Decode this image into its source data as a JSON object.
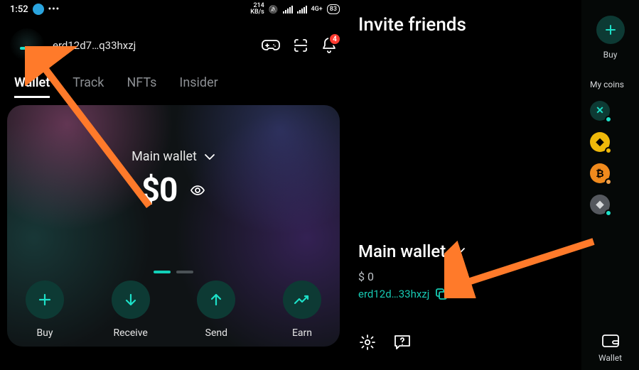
{
  "status": {
    "time": "1:52",
    "kb_top": "214",
    "kb_bottom": "KB/s",
    "net_top": "4G+",
    "battery": "83"
  },
  "profile": {
    "address": "erd12d7…q33hxzj",
    "badge": "4"
  },
  "tabs": {
    "wallet": "Wallet",
    "track": "Track",
    "nfts": "NFTs",
    "insider": "Insider"
  },
  "hero": {
    "wallet_name": "Main wallet",
    "balance": "$0"
  },
  "actions": {
    "buy": "Buy",
    "receive": "Receive",
    "send": "Send",
    "earn": "Earn"
  },
  "right": {
    "invite": "Invite friends",
    "wallet_name": "Main wallet",
    "balance": "$ 0",
    "address": "erd12d…33hxzj"
  },
  "far": {
    "buy": "Buy",
    "my_coins": "My coins",
    "wallet": "Wallet"
  }
}
